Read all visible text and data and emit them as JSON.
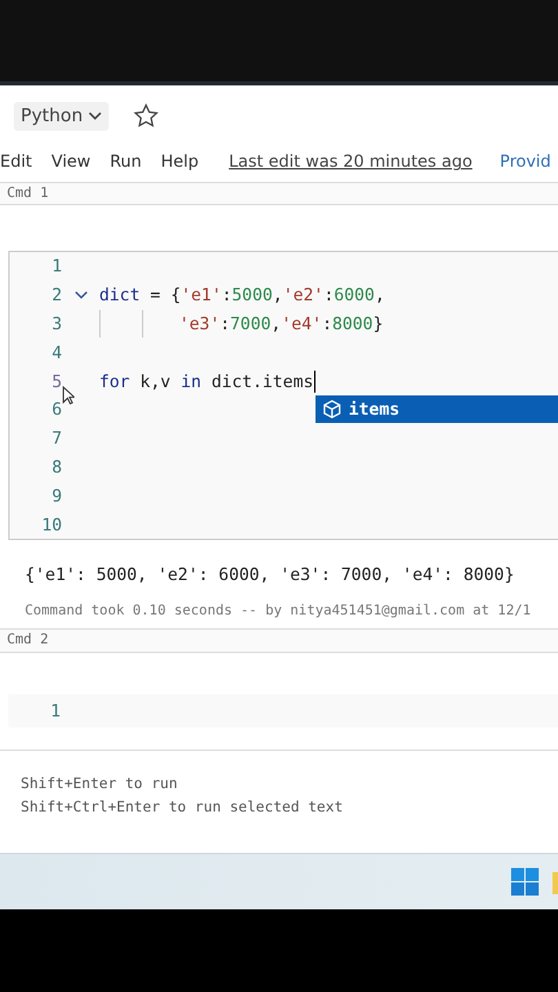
{
  "toolbar": {
    "language": "Python",
    "favorite": false
  },
  "menu": {
    "items": [
      "Edit",
      "View",
      "Run",
      "Help"
    ],
    "last_edit": "Last edit was 20 minutes ago",
    "provider": "Provid"
  },
  "cells": [
    {
      "label": "Cmd 1",
      "lines": [
        {
          "number": "1",
          "fold": false,
          "continuation": false,
          "cursor": false
        },
        {
          "number": "2",
          "fold": true,
          "continuation": false,
          "cursor": false,
          "tokens": [
            {
              "kind": "name",
              "text": "dict"
            },
            {
              "kind": "plain",
              "text": " = {"
            },
            {
              "kind": "string",
              "text": "'e1'"
            },
            {
              "kind": "plain",
              "text": ":"
            },
            {
              "kind": "number",
              "text": "5000"
            },
            {
              "kind": "plain",
              "text": ","
            },
            {
              "kind": "string",
              "text": "'e2'"
            },
            {
              "kind": "plain",
              "text": ":"
            },
            {
              "kind": "number",
              "text": "6000"
            },
            {
              "kind": "plain",
              "text": ","
            }
          ]
        },
        {
          "number": "3",
          "fold": false,
          "continuation": true,
          "cursor": false,
          "tokens": [
            {
              "kind": "string",
              "text": "'e3'"
            },
            {
              "kind": "plain",
              "text": ":"
            },
            {
              "kind": "number",
              "text": "7000"
            },
            {
              "kind": "plain",
              "text": ","
            },
            {
              "kind": "string",
              "text": "'e4'"
            },
            {
              "kind": "plain",
              "text": ":"
            },
            {
              "kind": "number",
              "text": "8000"
            },
            {
              "kind": "plain",
              "text": "}"
            }
          ]
        },
        {
          "number": "4",
          "fold": false,
          "continuation": false,
          "cursor": false
        },
        {
          "number": "5",
          "fold": false,
          "continuation": false,
          "cursor": true,
          "tokens": [
            {
              "kind": "keyword",
              "text": "for"
            },
            {
              "kind": "plain",
              "text": " k,v "
            },
            {
              "kind": "keyword",
              "text": "in"
            },
            {
              "kind": "plain",
              "text": " dict.items"
            }
          ],
          "suggestion": "items"
        },
        {
          "number": "6",
          "fold": false,
          "continuation": false,
          "cursor": false
        },
        {
          "number": "7",
          "fold": false,
          "continuation": false,
          "cursor": false
        },
        {
          "number": "8",
          "fold": false,
          "continuation": false,
          "cursor": false
        },
        {
          "number": "9",
          "fold": false,
          "continuation": false,
          "cursor": false
        },
        {
          "number": "10",
          "fold": false,
          "continuation": false,
          "cursor": false
        }
      ],
      "output": "{'e1': 5000, 'e2': 6000, 'e3': 7000, 'e4': 8000}",
      "status": "Command took 0.10 seconds -- by nitya451451@gmail.com at 12/1"
    },
    {
      "label": "Cmd 2",
      "lines": [
        {
          "number": "1",
          "fold": false,
          "continuation": false,
          "cursor": false
        }
      ]
    }
  ],
  "hints": [
    "Shift+Enter to run",
    "Shift+Ctrl+Enter to run selected text"
  ]
}
